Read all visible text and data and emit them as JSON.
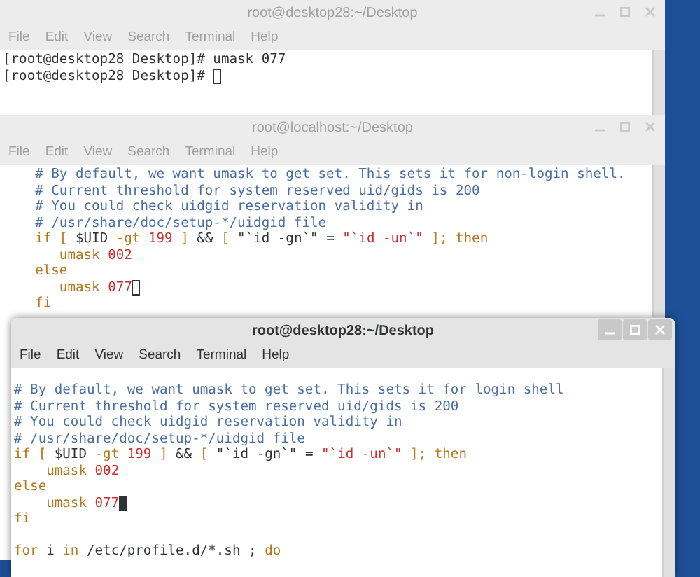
{
  "windows": [
    {
      "title": "root@desktop28:~/Desktop",
      "focused": false,
      "menu": [
        "File",
        "Edit",
        "View",
        "Search",
        "Terminal",
        "Help"
      ],
      "lines": [
        {
          "segments": [
            {
              "kind": "plain",
              "text": "[root@desktop28 Desktop]# umask 077"
            }
          ],
          "cursor": false
        },
        {
          "segments": [
            {
              "kind": "plain",
              "text": "[root@desktop28 Desktop]# "
            }
          ],
          "cursor": true
        }
      ]
    },
    {
      "title": "root@localhost:~/Desktop",
      "focused": false,
      "menu": [
        "File",
        "Edit",
        "View",
        "Search",
        "Terminal",
        "Help"
      ],
      "lines": [
        {
          "segments": [
            {
              "kind": "comment",
              "text": "    # By default, we want umask to get set. This sets it for non-login shell."
            }
          ],
          "cursor": false
        },
        {
          "segments": [
            {
              "kind": "comment",
              "text": "    # Current threshold for system reserved uid/gids is 200"
            }
          ],
          "cursor": false
        },
        {
          "segments": [
            {
              "kind": "comment",
              "text": "    # You could check uidgid reservation validity in"
            }
          ],
          "cursor": false
        },
        {
          "segments": [
            {
              "kind": "comment",
              "text": "    # /usr/share/doc/setup-*/uidgid file"
            }
          ],
          "cursor": false
        },
        {
          "segments": [
            {
              "kind": "keyword",
              "text": "    if ["
            },
            {
              "kind": "plain",
              "text": " $UID "
            },
            {
              "kind": "keyword",
              "text": "-gt "
            },
            {
              "kind": "number",
              "text": "199"
            },
            {
              "kind": "keyword",
              "text": " ] "
            },
            {
              "kind": "plain",
              "text": "&&"
            },
            {
              "kind": "keyword",
              "text": " [ "
            },
            {
              "kind": "plain",
              "text": "\"`id -gn`\" = "
            },
            {
              "kind": "string",
              "text": "\"`id -un`\""
            },
            {
              "kind": "keyword",
              "text": " ]; then"
            }
          ],
          "cursor": false
        },
        {
          "segments": [
            {
              "kind": "keyword",
              "text": "       umask "
            },
            {
              "kind": "number",
              "text": "002"
            }
          ],
          "cursor": false
        },
        {
          "segments": [
            {
              "kind": "keyword",
              "text": "    else"
            }
          ],
          "cursor": false
        },
        {
          "segments": [
            {
              "kind": "keyword",
              "text": "       umask "
            },
            {
              "kind": "number",
              "text": "077"
            }
          ],
          "cursor": true
        },
        {
          "segments": [
            {
              "kind": "keyword",
              "text": "    fi"
            }
          ],
          "cursor": false
        }
      ]
    },
    {
      "title": "root@desktop28:~/Desktop",
      "focused": true,
      "menu": [
        "File",
        "Edit",
        "View",
        "Search",
        "Terminal",
        "Help"
      ],
      "lines": [
        {
          "segments": [
            {
              "kind": "comment",
              "text": "# By default, we want umask to get set. This sets it for login shell"
            }
          ],
          "cursor": false
        },
        {
          "segments": [
            {
              "kind": "comment",
              "text": "# Current threshold for system reserved uid/gids is 200"
            }
          ],
          "cursor": false
        },
        {
          "segments": [
            {
              "kind": "comment",
              "text": "# You could check uidgid reservation validity in"
            }
          ],
          "cursor": false
        },
        {
          "segments": [
            {
              "kind": "comment",
              "text": "# /usr/share/doc/setup-*/uidgid file"
            }
          ],
          "cursor": false
        },
        {
          "segments": [
            {
              "kind": "keyword",
              "text": "if ["
            },
            {
              "kind": "plain",
              "text": " $UID "
            },
            {
              "kind": "keyword",
              "text": "-gt "
            },
            {
              "kind": "number",
              "text": "199"
            },
            {
              "kind": "keyword",
              "text": " ] "
            },
            {
              "kind": "plain",
              "text": "&&"
            },
            {
              "kind": "keyword",
              "text": " [ "
            },
            {
              "kind": "plain",
              "text": "\"`id -gn`\" = "
            },
            {
              "kind": "string",
              "text": "\"`id -un`\""
            },
            {
              "kind": "keyword",
              "text": " ]; then"
            }
          ],
          "cursor": false
        },
        {
          "segments": [
            {
              "kind": "keyword",
              "text": "    umask "
            },
            {
              "kind": "number",
              "text": "002"
            }
          ],
          "cursor": false
        },
        {
          "segments": [
            {
              "kind": "keyword",
              "text": "else"
            }
          ],
          "cursor": false
        },
        {
          "segments": [
            {
              "kind": "keyword",
              "text": "    umask "
            },
            {
              "kind": "number",
              "text": "077"
            }
          ],
          "cursor": true
        },
        {
          "segments": [
            {
              "kind": "keyword",
              "text": "fi"
            }
          ],
          "cursor": false
        },
        {
          "gap_before": true,
          "segments": [
            {
              "kind": "keyword",
              "text": "for"
            },
            {
              "kind": "plain",
              "text": " i "
            },
            {
              "kind": "keyword",
              "text": "in"
            },
            {
              "kind": "plain",
              "text": " /etc/profile.d/*.sh ; "
            },
            {
              "kind": "keyword",
              "text": "do"
            }
          ],
          "cursor": false
        }
      ]
    }
  ]
}
